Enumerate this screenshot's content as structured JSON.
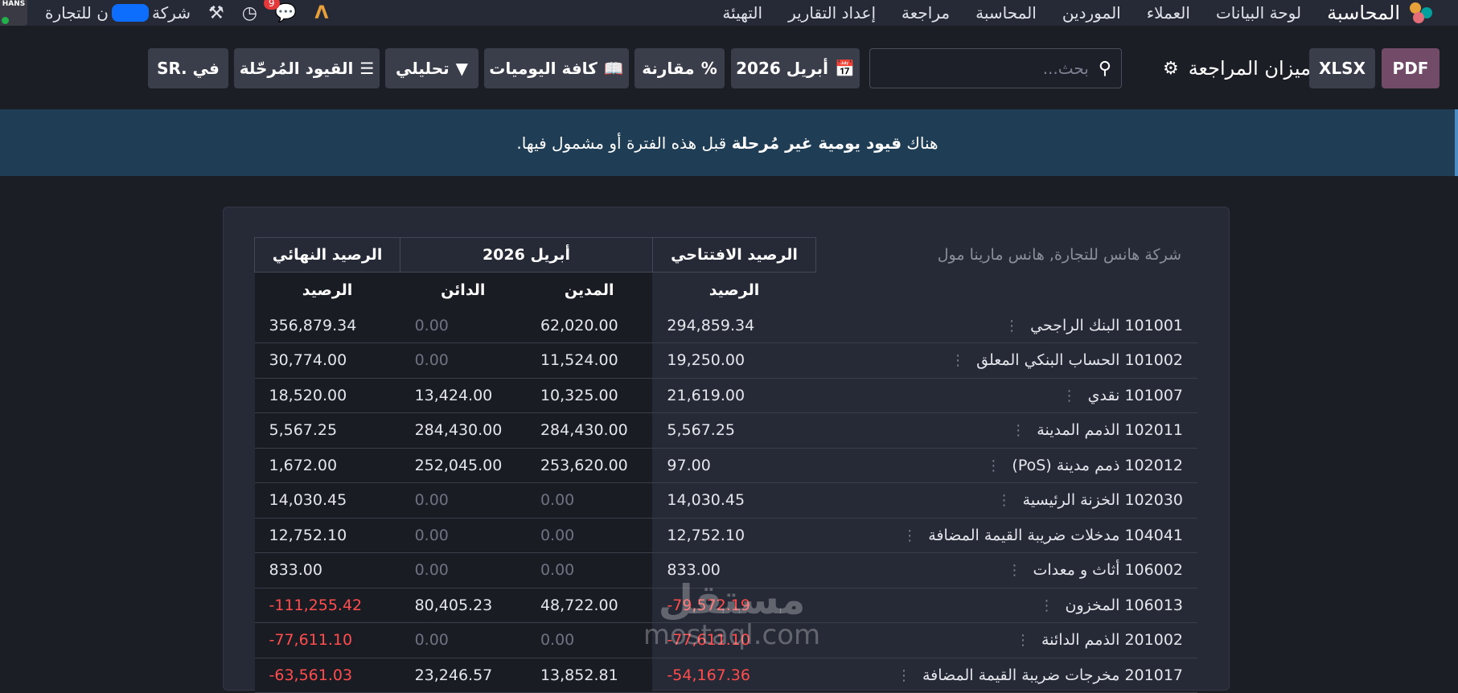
{
  "topbar": {
    "app_title": "المحاسبة",
    "nav": [
      "لوحة البيانات",
      "العملاء",
      "الموردين",
      "المحاسبة",
      "مراجعة",
      "إعداد التقارير",
      "التهيئة"
    ],
    "company_prefix": "شركة",
    "company_suffix": "ن للتجارة",
    "avatar_text": "HANS",
    "messages_badge": "9"
  },
  "controls": {
    "pdf": "PDF",
    "xlsx": "XLSX",
    "title": "ميزان المراجعة",
    "search_placeholder": "بحث...",
    "date_filter": "أبريل 2026",
    "comparison": "مقارنة",
    "journals": "كافة اليوميات",
    "analytic": "تحليلي",
    "posted": "القيود المُرحّلة",
    "currency": "في .SR"
  },
  "alert": {
    "prefix": "هناك ",
    "bold": "قيود يومية غير مُرحلة",
    "suffix": " قبل هذه الفترة أو مشمول فيها."
  },
  "report": {
    "company": "شركة هانس للتجارة, هانس مارينا مول",
    "group_headers": {
      "initial": "الرصيد الافتتاحي",
      "period": "أبريل 2026",
      "end": "الرصيد النهائي"
    },
    "sub_headers": {
      "initial_balance": "الرصيد",
      "debit": "المدين",
      "credit": "الدائن",
      "end_balance": "الرصيد"
    },
    "rows": [
      {
        "account": "101001 البنك الراجحي",
        "initial": "294,859.34",
        "debit": "62,020.00",
        "credit": "0.00",
        "end": "356,879.34"
      },
      {
        "account": "101002 الحساب البنكي المعلق",
        "initial": "19,250.00",
        "debit": "11,524.00",
        "credit": "0.00",
        "end": "30,774.00"
      },
      {
        "account": "101007 نقدي",
        "initial": "21,619.00",
        "debit": "10,325.00",
        "credit": "13,424.00",
        "end": "18,520.00"
      },
      {
        "account": "102011 الذمم المدينة",
        "initial": "5,567.25",
        "debit": "284,430.00",
        "credit": "284,430.00",
        "end": "5,567.25"
      },
      {
        "account": "102012 ذمم مدينة (PoS)",
        "initial": "97.00",
        "debit": "253,620.00",
        "credit": "252,045.00",
        "end": "1,672.00"
      },
      {
        "account": "102030 الخزنة الرئيسية",
        "initial": "14,030.45",
        "debit": "0.00",
        "credit": "0.00",
        "end": "14,030.45"
      },
      {
        "account": "104041 مدخلات ضريبة القيمة المضافة",
        "initial": "12,752.10",
        "debit": "0.00",
        "credit": "0.00",
        "end": "12,752.10"
      },
      {
        "account": "106002 أثاث و معدات",
        "initial": "833.00",
        "debit": "0.00",
        "credit": "0.00",
        "end": "833.00"
      },
      {
        "account": "106013 المخزون",
        "initial": "79,572.19-",
        "debit": "48,722.00",
        "credit": "80,405.23",
        "end": "111,255.42-"
      },
      {
        "account": "201002 الذمم الدائنة",
        "initial": "77,611.10-",
        "debit": "0.00",
        "credit": "0.00",
        "end": "77,611.10-"
      },
      {
        "account": "201017 مخرجات ضريبة القيمة المضافة",
        "initial": "54,167.36-",
        "debit": "13,852.81",
        "credit": "23,246.57",
        "end": "63,561.03-"
      }
    ]
  },
  "watermark": {
    "arabic": "مستقل",
    "latin": "mostaql.com"
  }
}
